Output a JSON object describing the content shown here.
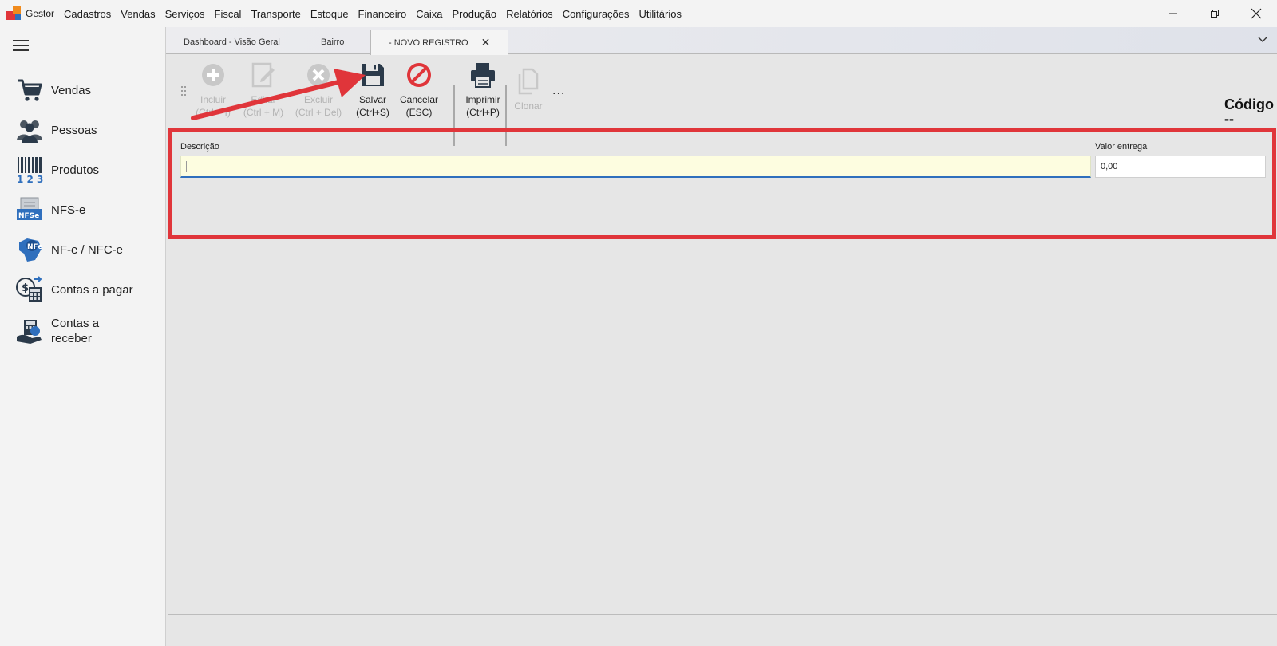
{
  "menu": {
    "items": [
      "Gestor",
      "Cadastros",
      "Vendas",
      "Serviços",
      "Fiscal",
      "Transporte",
      "Estoque",
      "Financeiro",
      "Caixa",
      "Produção",
      "Relatórios",
      "Configurações",
      "Utilitários"
    ]
  },
  "sidebar": {
    "items": [
      {
        "label": "Vendas",
        "icon": "cart-icon"
      },
      {
        "label": "Pessoas",
        "icon": "people-icon"
      },
      {
        "label": "Produtos",
        "icon": "barcode-icon"
      },
      {
        "label": "NFS-e",
        "icon": "nfse-icon"
      },
      {
        "label": "NF-e / NFC-e",
        "icon": "nfe-icon"
      },
      {
        "label": "Contas a pagar",
        "icon": "bill-pay-icon"
      },
      {
        "label": "Contas a receber",
        "icon": "bill-receive-icon"
      }
    ]
  },
  "tabs": [
    {
      "label": "Dashboard - Visão Geral"
    },
    {
      "label": "Bairro"
    },
    {
      "label": "- NOVO REGISTRO"
    }
  ],
  "toolbar": {
    "incluir": {
      "label": "Incluir",
      "shortcut": "(Ctrl + I)"
    },
    "editar": {
      "label": "Editar",
      "shortcut": "(Ctrl + M)"
    },
    "excluir": {
      "label": "Excluir",
      "shortcut": "(Ctrl + Del)"
    },
    "salvar": {
      "label": "Salvar",
      "shortcut": "(Ctrl+S)"
    },
    "cancelar": {
      "label": "Cancelar",
      "shortcut": "(ESC)"
    },
    "imprimir": {
      "label": "Imprimir",
      "shortcut": "(Ctrl+P)"
    },
    "clonar": {
      "label": "Clonar"
    },
    "more": "..."
  },
  "codigo": {
    "title": "Código",
    "value": "--"
  },
  "form": {
    "descricao": {
      "label": "Descrição",
      "value": ""
    },
    "valor_entrega": {
      "label": "Valor entrega",
      "value": "0,00"
    }
  },
  "colors": {
    "accent": "#2f6fbd",
    "highlight": "#e0353a",
    "cancel": "#e0353a",
    "icon_dark": "#2b3a4a"
  }
}
